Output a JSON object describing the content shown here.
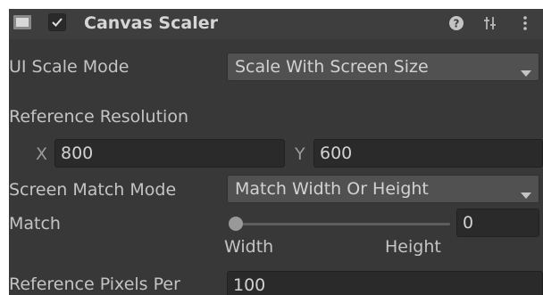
{
  "component": {
    "title": "Canvas Scaler",
    "enabled": true,
    "icons": [
      "canvas-scaler-component-icon",
      "help-icon",
      "presets-icon",
      "kebab-menu-icon"
    ]
  },
  "ui_scale_mode": {
    "label": "UI Scale Mode",
    "value": "Scale With Screen Size"
  },
  "reference_resolution": {
    "label": "Reference Resolution",
    "x_label": "X",
    "x_value": "800",
    "y_label": "Y",
    "y_value": "600"
  },
  "screen_match_mode": {
    "label": "Screen Match Mode",
    "value": "Match Width Or Height"
  },
  "match": {
    "label": "Match",
    "value": "0",
    "level": 0,
    "min_label": "Width",
    "max_label": "Height"
  },
  "reference_pixels_per_unit": {
    "label": "Reference Pixels Per",
    "value": "100"
  },
  "colors": {
    "background": "#383838",
    "header": "#3e3e3e",
    "field": "#2a2a2a",
    "dropdown": "#515151",
    "text": "#c4c4c4"
  }
}
